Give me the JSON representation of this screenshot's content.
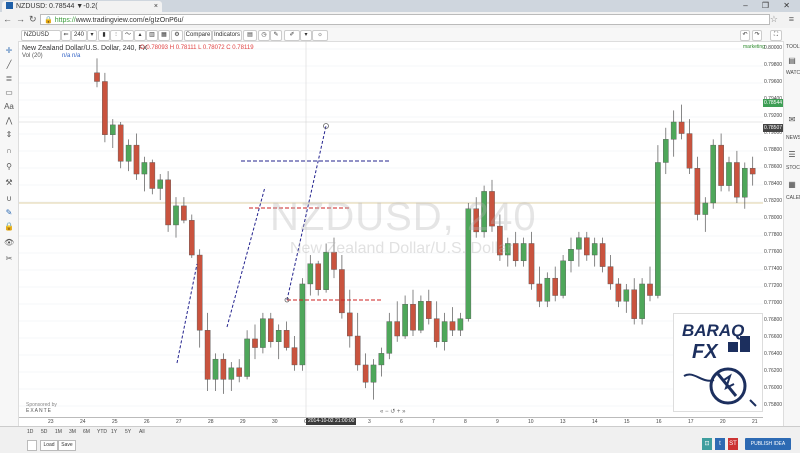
{
  "browser": {
    "tab_title": "NZDUSD: 0.78544 ▼-0.2(",
    "url_protocol": "https://",
    "url_rest": "www.tradingview.com/e/gIzOnP6u/",
    "window_controls": "– ❐ ✕"
  },
  "toolbar": {
    "symbol": "NZDUSD",
    "compare": "Compare",
    "indicators": "Indicators"
  },
  "chart": {
    "title": "New Zealand Dollar/U.S. Dollar, 240, FX",
    "vol": "Vol (20)",
    "na1": "n/a",
    "na2": "n/a",
    "ohlc": "O 0.78093 H 0.78111 L 0.78072 C 0.78119",
    "watermark_symbol": "NZDUSD, 240",
    "watermark_name": "New Zealand Dollar/U.S. Dollar",
    "sponsored": "Sponsored by",
    "sponsor_name": "EXANTE",
    "time_cursor": "2014-10-02 21:00:00",
    "logo_line1": "BARAQ",
    "logo_line2": "FX",
    "marketing": "marketing"
  },
  "price_labels": [
    "0.80000",
    "0.79800",
    "0.79600",
    "0.79400",
    "0.79200",
    "0.79000",
    "0.78800",
    "0.78600",
    "0.78400",
    "0.78200",
    "0.78000",
    "0.77800",
    "0.77600",
    "0.77400",
    "0.77200",
    "0.77000",
    "0.76800",
    "0.76600",
    "0.76400",
    "0.76200",
    "0.76000",
    "0.75800"
  ],
  "current_price": "0.78544",
  "current_price2": "0.78507",
  "time_labels": [
    "23",
    "24",
    "25",
    "26",
    "27",
    "28",
    "29",
    "30",
    "Oct",
    "2",
    "3",
    "6",
    "7",
    "8",
    "9",
    "10",
    "13",
    "14",
    "15",
    "16",
    "17",
    "20",
    "21"
  ],
  "ranges": [
    "1D",
    "5D",
    "1M",
    "3M",
    "6M",
    "YTD",
    "1Y",
    "5Y",
    "All"
  ],
  "bottom": {
    "load": "Load",
    "save": "Save",
    "publish": "PUBLISH IDEA",
    "st": "ST"
  },
  "right_side_labels": [
    "TOOLS",
    "WATCH",
    "NEWS",
    "STOCKT",
    "CALEND"
  ],
  "candles": [
    {
      "o": 0.7975,
      "h": 0.8,
      "l": 0.795,
      "c": 0.796
    },
    {
      "o": 0.796,
      "h": 0.7975,
      "l": 0.7855,
      "c": 0.7868
    },
    {
      "o": 0.7868,
      "h": 0.7895,
      "l": 0.7845,
      "c": 0.7885
    },
    {
      "o": 0.7885,
      "h": 0.789,
      "l": 0.781,
      "c": 0.7822
    },
    {
      "o": 0.7822,
      "h": 0.786,
      "l": 0.7805,
      "c": 0.785
    },
    {
      "o": 0.785,
      "h": 0.787,
      "l": 0.779,
      "c": 0.78
    },
    {
      "o": 0.78,
      "h": 0.783,
      "l": 0.777,
      "c": 0.782
    },
    {
      "o": 0.782,
      "h": 0.7825,
      "l": 0.7765,
      "c": 0.7775
    },
    {
      "o": 0.7775,
      "h": 0.78,
      "l": 0.7755,
      "c": 0.779
    },
    {
      "o": 0.779,
      "h": 0.7805,
      "l": 0.77,
      "c": 0.7712
    },
    {
      "o": 0.7712,
      "h": 0.776,
      "l": 0.769,
      "c": 0.7745
    },
    {
      "o": 0.7745,
      "h": 0.776,
      "l": 0.7715,
      "c": 0.772
    },
    {
      "o": 0.772,
      "h": 0.773,
      "l": 0.7655,
      "c": 0.766
    },
    {
      "o": 0.766,
      "h": 0.767,
      "l": 0.75,
      "c": 0.753
    },
    {
      "o": 0.753,
      "h": 0.756,
      "l": 0.7425,
      "c": 0.7445
    },
    {
      "o": 0.7445,
      "h": 0.749,
      "l": 0.7425,
      "c": 0.748
    },
    {
      "o": 0.748,
      "h": 0.749,
      "l": 0.742,
      "c": 0.7445
    },
    {
      "o": 0.7445,
      "h": 0.7475,
      "l": 0.7425,
      "c": 0.7465
    },
    {
      "o": 0.7465,
      "h": 0.748,
      "l": 0.744,
      "c": 0.745
    },
    {
      "o": 0.745,
      "h": 0.753,
      "l": 0.7445,
      "c": 0.7515
    },
    {
      "o": 0.7515,
      "h": 0.754,
      "l": 0.748,
      "c": 0.75
    },
    {
      "o": 0.75,
      "h": 0.756,
      "l": 0.749,
      "c": 0.755
    },
    {
      "o": 0.755,
      "h": 0.756,
      "l": 0.75,
      "c": 0.751
    },
    {
      "o": 0.751,
      "h": 0.754,
      "l": 0.748,
      "c": 0.753
    },
    {
      "o": 0.753,
      "h": 0.7545,
      "l": 0.7495,
      "c": 0.75
    },
    {
      "o": 0.75,
      "h": 0.752,
      "l": 0.746,
      "c": 0.747
    },
    {
      "o": 0.747,
      "h": 0.762,
      "l": 0.746,
      "c": 0.761
    },
    {
      "o": 0.761,
      "h": 0.766,
      "l": 0.759,
      "c": 0.7645
    },
    {
      "o": 0.7645,
      "h": 0.765,
      "l": 0.759,
      "c": 0.76
    },
    {
      "o": 0.76,
      "h": 0.768,
      "l": 0.7595,
      "c": 0.7665
    },
    {
      "o": 0.7665,
      "h": 0.769,
      "l": 0.762,
      "c": 0.7635
    },
    {
      "o": 0.7635,
      "h": 0.766,
      "l": 0.755,
      "c": 0.756
    },
    {
      "o": 0.756,
      "h": 0.76,
      "l": 0.75,
      "c": 0.752
    },
    {
      "o": 0.752,
      "h": 0.756,
      "l": 0.746,
      "c": 0.747
    },
    {
      "o": 0.747,
      "h": 0.749,
      "l": 0.743,
      "c": 0.744
    },
    {
      "o": 0.744,
      "h": 0.748,
      "l": 0.741,
      "c": 0.747
    },
    {
      "o": 0.747,
      "h": 0.75,
      "l": 0.745,
      "c": 0.749
    },
    {
      "o": 0.749,
      "h": 0.756,
      "l": 0.748,
      "c": 0.7545
    },
    {
      "o": 0.7545,
      "h": 0.758,
      "l": 0.751,
      "c": 0.752
    },
    {
      "o": 0.752,
      "h": 0.759,
      "l": 0.7515,
      "c": 0.7575
    },
    {
      "o": 0.7575,
      "h": 0.76,
      "l": 0.752,
      "c": 0.753
    },
    {
      "o": 0.753,
      "h": 0.759,
      "l": 0.7525,
      "c": 0.758
    },
    {
      "o": 0.758,
      "h": 0.76,
      "l": 0.754,
      "c": 0.755
    },
    {
      "o": 0.755,
      "h": 0.758,
      "l": 0.75,
      "c": 0.751
    },
    {
      "o": 0.751,
      "h": 0.756,
      "l": 0.7495,
      "c": 0.7545
    },
    {
      "o": 0.7545,
      "h": 0.757,
      "l": 0.752,
      "c": 0.753
    },
    {
      "o": 0.753,
      "h": 0.756,
      "l": 0.752,
      "c": 0.755
    },
    {
      "o": 0.755,
      "h": 0.775,
      "l": 0.7545,
      "c": 0.774
    },
    {
      "o": 0.774,
      "h": 0.776,
      "l": 0.769,
      "c": 0.77
    },
    {
      "o": 0.77,
      "h": 0.778,
      "l": 0.769,
      "c": 0.777
    },
    {
      "o": 0.777,
      "h": 0.779,
      "l": 0.77,
      "c": 0.771
    },
    {
      "o": 0.771,
      "h": 0.773,
      "l": 0.765,
      "c": 0.766
    },
    {
      "o": 0.766,
      "h": 0.769,
      "l": 0.764,
      "c": 0.768
    },
    {
      "o": 0.768,
      "h": 0.77,
      "l": 0.764,
      "c": 0.765
    },
    {
      "o": 0.765,
      "h": 0.769,
      "l": 0.764,
      "c": 0.768
    },
    {
      "o": 0.768,
      "h": 0.77,
      "l": 0.76,
      "c": 0.761
    },
    {
      "o": 0.761,
      "h": 0.764,
      "l": 0.757,
      "c": 0.758
    },
    {
      "o": 0.758,
      "h": 0.763,
      "l": 0.757,
      "c": 0.762
    },
    {
      "o": 0.762,
      "h": 0.764,
      "l": 0.758,
      "c": 0.759
    },
    {
      "o": 0.759,
      "h": 0.766,
      "l": 0.7585,
      "c": 0.765
    },
    {
      "o": 0.765,
      "h": 0.769,
      "l": 0.763,
      "c": 0.767
    },
    {
      "o": 0.767,
      "h": 0.77,
      "l": 0.764,
      "c": 0.769
    },
    {
      "o": 0.769,
      "h": 0.77,
      "l": 0.765,
      "c": 0.766
    },
    {
      "o": 0.766,
      "h": 0.769,
      "l": 0.764,
      "c": 0.768
    },
    {
      "o": 0.768,
      "h": 0.769,
      "l": 0.763,
      "c": 0.764
    },
    {
      "o": 0.764,
      "h": 0.766,
      "l": 0.76,
      "c": 0.761
    },
    {
      "o": 0.761,
      "h": 0.762,
      "l": 0.757,
      "c": 0.758
    },
    {
      "o": 0.758,
      "h": 0.761,
      "l": 0.756,
      "c": 0.76
    },
    {
      "o": 0.76,
      "h": 0.762,
      "l": 0.754,
      "c": 0.755
    },
    {
      "o": 0.755,
      "h": 0.762,
      "l": 0.754,
      "c": 0.761
    },
    {
      "o": 0.761,
      "h": 0.764,
      "l": 0.758,
      "c": 0.759
    },
    {
      "o": 0.759,
      "h": 0.785,
      "l": 0.7585,
      "c": 0.782
    },
    {
      "o": 0.782,
      "h": 0.788,
      "l": 0.78,
      "c": 0.786
    },
    {
      "o": 0.786,
      "h": 0.791,
      "l": 0.783,
      "c": 0.789
    },
    {
      "o": 0.789,
      "h": 0.792,
      "l": 0.786,
      "c": 0.787
    },
    {
      "o": 0.787,
      "h": 0.7895,
      "l": 0.78,
      "c": 0.781
    },
    {
      "o": 0.781,
      "h": 0.783,
      "l": 0.772,
      "c": 0.773
    },
    {
      "o": 0.773,
      "h": 0.776,
      "l": 0.77,
      "c": 0.775
    },
    {
      "o": 0.775,
      "h": 0.786,
      "l": 0.774,
      "c": 0.785
    },
    {
      "o": 0.785,
      "h": 0.787,
      "l": 0.777,
      "c": 0.778
    },
    {
      "o": 0.778,
      "h": 0.783,
      "l": 0.777,
      "c": 0.782
    },
    {
      "o": 0.782,
      "h": 0.784,
      "l": 0.775,
      "c": 0.776
    },
    {
      "o": 0.776,
      "h": 0.782,
      "l": 0.774,
      "c": 0.781
    },
    {
      "o": 0.781,
      "h": 0.783,
      "l": 0.778,
      "c": 0.78
    }
  ]
}
